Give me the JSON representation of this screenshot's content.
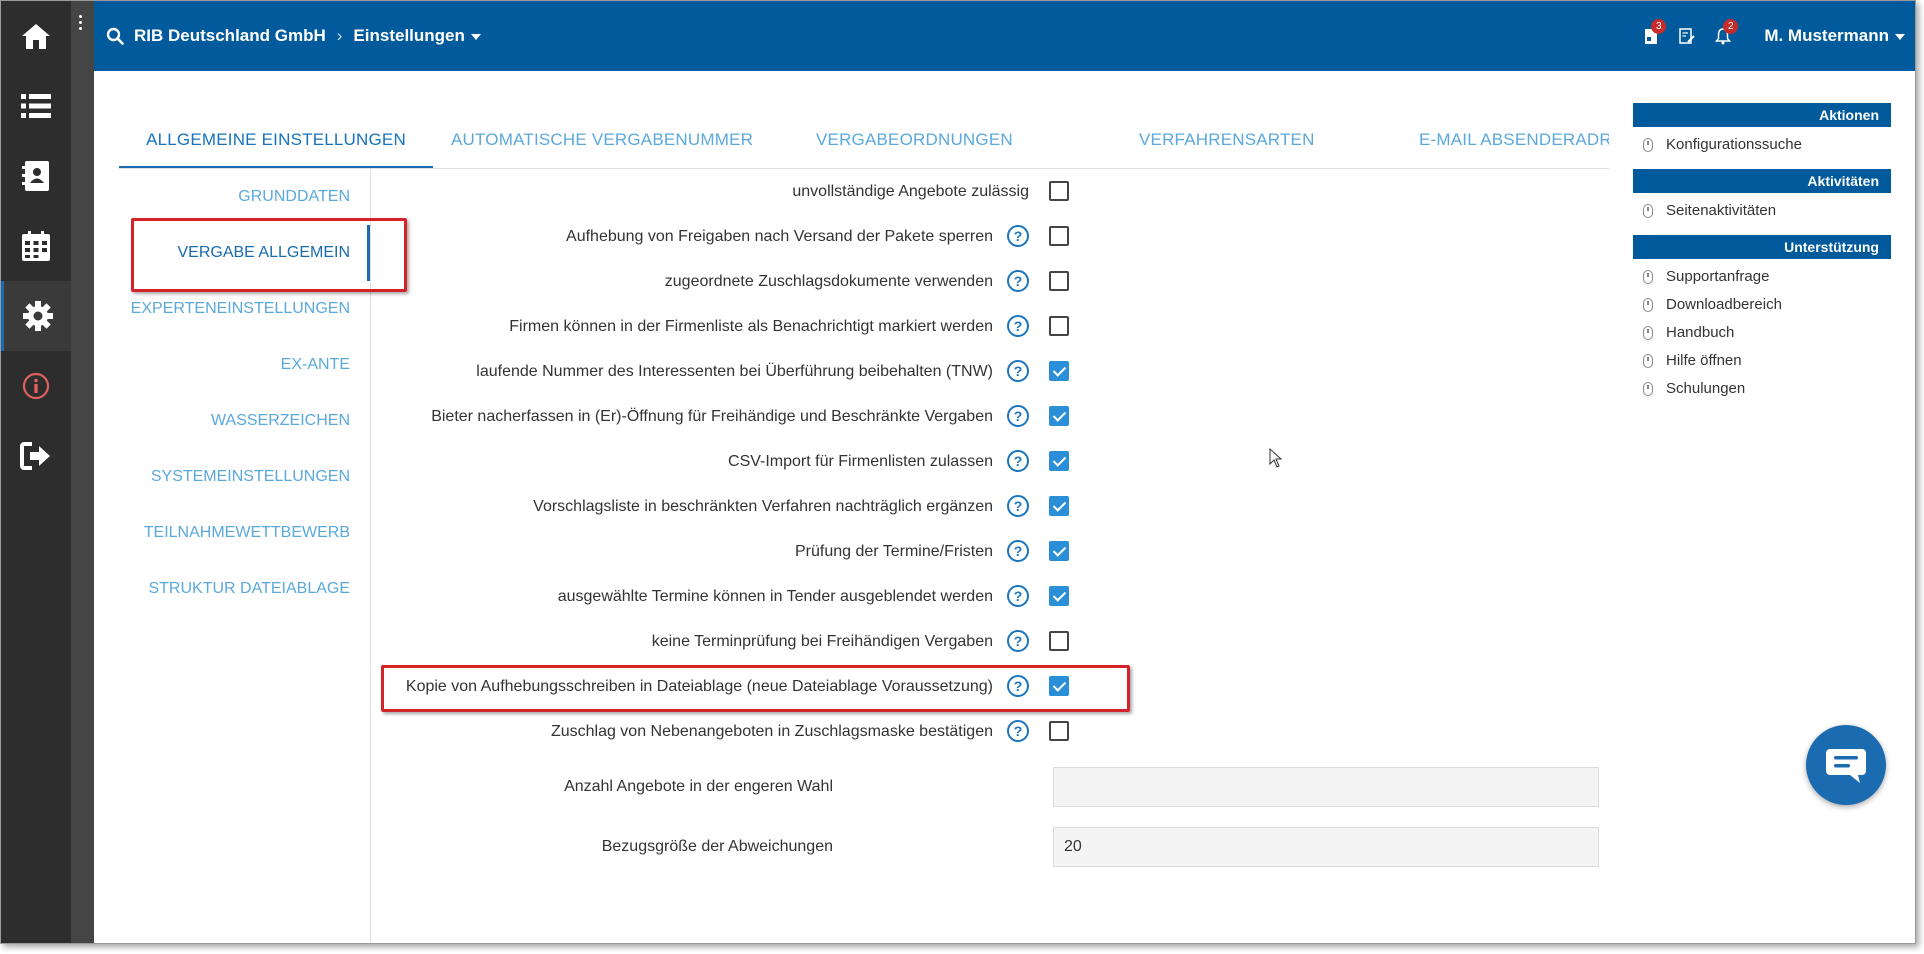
{
  "nav_icons": [
    "home-icon",
    "list-icon",
    "contacts-icon",
    "calendar-icon",
    "gear-icon",
    "info-icon",
    "logout-icon"
  ],
  "header": {
    "company": "RIB Deutschland GmbH",
    "section": "Einstellungen",
    "badge_tasks": "3",
    "badge_notifications": "2",
    "user": "M. Mustermann"
  },
  "tabs": [
    "ALLGEMEINE EINSTELLUNGEN",
    "AUTOMATISCHE VERGABENUMMER",
    "VERGABEORDNUNGEN",
    "VERFAHRENSARTEN",
    "E-MAIL ABSENDERADRES"
  ],
  "active_tab": 0,
  "submenu": [
    "GRUNDDATEN",
    "VERGABE ALLGEMEIN",
    "EXPERTENEINSTELLUNGEN",
    "EX-ANTE",
    "WASSERZEICHEN",
    "SYSTEMEINSTELLUNGEN",
    "TEILNAHMEWETTBEWERB",
    "STRUKTUR DATEIABLAGE"
  ],
  "active_submenu": 1,
  "settings": [
    {
      "label": "unvollständige Angebote zulässig",
      "help": false,
      "checked": false
    },
    {
      "label": "Aufhebung von Freigaben nach Versand der Pakete sperren",
      "help": true,
      "checked": false
    },
    {
      "label": "zugeordnete Zuschlagsdokumente verwenden",
      "help": true,
      "checked": false
    },
    {
      "label": "Firmen können in der Firmenliste als Benachrichtigt markiert werden",
      "help": true,
      "checked": false
    },
    {
      "label": "laufende Nummer des Interessenten bei Überführung beibehalten (TNW)",
      "help": true,
      "checked": true
    },
    {
      "label": "Bieter nacherfassen in (Er)-Öffnung für Freihändige und Beschränkte Vergaben",
      "help": true,
      "checked": true
    },
    {
      "label": "CSV-Import für Firmenlisten zulassen",
      "help": true,
      "checked": true
    },
    {
      "label": "Vorschlagsliste in beschränkten Verfahren nachträglich ergänzen",
      "help": true,
      "checked": true
    },
    {
      "label": "Prüfung der Termine/Fristen",
      "help": true,
      "checked": true
    },
    {
      "label": "ausgewählte Termine können in Tender ausgeblendet werden",
      "help": true,
      "checked": true
    },
    {
      "label": "keine Terminprüfung bei Freihändigen Vergaben",
      "help": true,
      "checked": false
    },
    {
      "label": "Kopie von Aufhebungsschreiben in Dateiablage (neue Dateiablage Voraussetzung)",
      "help": true,
      "checked": true
    },
    {
      "label": "Zuschlag von Nebenangeboten in Zuschlagsmaske bestätigen",
      "help": true,
      "checked": false
    }
  ],
  "help_glyph": "?",
  "inputs": [
    {
      "label": "Anzahl Angebote in der engeren Wahl",
      "value": ""
    },
    {
      "label": "Bezugsgröße der Abweichungen",
      "value": "20"
    }
  ],
  "right_panel": [
    {
      "title": "Aktionen",
      "items": [
        "Konfigurationssuche"
      ]
    },
    {
      "title": "Aktivitäten",
      "items": [
        "Seitenaktivitäten"
      ]
    },
    {
      "title": "Unterstützung",
      "items": [
        "Supportanfrage",
        "Downloadbereich",
        "Handbuch",
        "Hilfe öffnen",
        "Schulungen"
      ]
    }
  ],
  "colors": {
    "header": "#015a9c",
    "accent": "#1a6bb0",
    "sidebar": "#2d2d2d",
    "checkbox_on": "#2b8fd8",
    "highlight": "#d3232a"
  }
}
